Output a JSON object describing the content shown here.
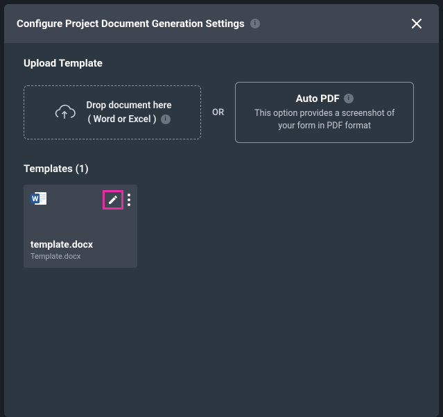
{
  "header": {
    "title": "Configure Project Document Generation Settings"
  },
  "upload": {
    "section_title": "Upload Template",
    "drop_line1": "Drop document here",
    "drop_line2": "( Word or Excel )",
    "or_label": "OR",
    "auto_pdf_title": "Auto PDF",
    "auto_pdf_desc": "This option provides a screenshot of your form in PDF format"
  },
  "templates": {
    "title": "Templates (1)",
    "items": [
      {
        "name": "template.docx",
        "subtitle": "Template.docx"
      }
    ]
  }
}
